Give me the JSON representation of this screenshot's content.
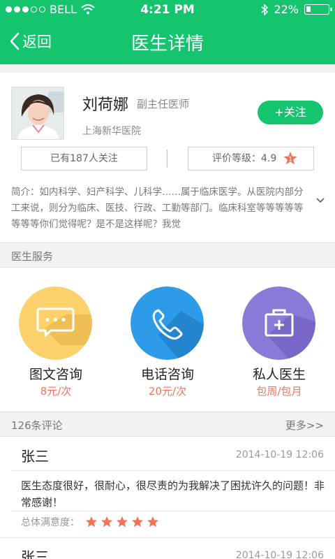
{
  "status_bar": {
    "carrier": "BELL",
    "time": "4:21 PM",
    "battery": "22%",
    "battery_level": 0.22
  },
  "nav": {
    "back_label": "返回",
    "title": "医生详情"
  },
  "doctor": {
    "name": "刘荷娜",
    "title": "副主任医师",
    "hospital": "上海新华医院",
    "follow_label": "+关注",
    "followers": "已有187人关注",
    "rating_label": "评价等级：4.9",
    "rating_badge": "1",
    "intro": "简介：如内科学、妇产科学、儿科学……属于临床医学。从医院内部分工来说，则分为临床、医技、行政、工勤等部门。临床科室等等等等等等等等你们觉得呢？是不是这样呢？我觉"
  },
  "services_section": {
    "title": "医生服务"
  },
  "services": [
    {
      "label": "图文咨询",
      "price": "8元/次",
      "icon": "chat-bubble-icon",
      "color": "#fcd06b"
    },
    {
      "label": "电话咨询",
      "price": "20元/次",
      "icon": "phone-icon",
      "color": "#2d9be8"
    },
    {
      "label": "私人医生",
      "price": "包周/包月",
      "icon": "medical-kit-icon",
      "color": "#8b79d8"
    }
  ],
  "comments_section": {
    "count_label": "126条评论",
    "more_label": "更多>>"
  },
  "comments": [
    {
      "user": "张三",
      "time": "2014-10-19 12:06",
      "text": "医生态度很好，很耐心，很尽责的为我解决了困扰许久的问题！非常感谢！",
      "satisfaction_label": "总体满意度：",
      "stars": 5
    },
    {
      "user": "张三",
      "time": "2014-10-19 12:06"
    }
  ],
  "colors": {
    "brand": "#14c46e",
    "accent": "#f07455"
  }
}
